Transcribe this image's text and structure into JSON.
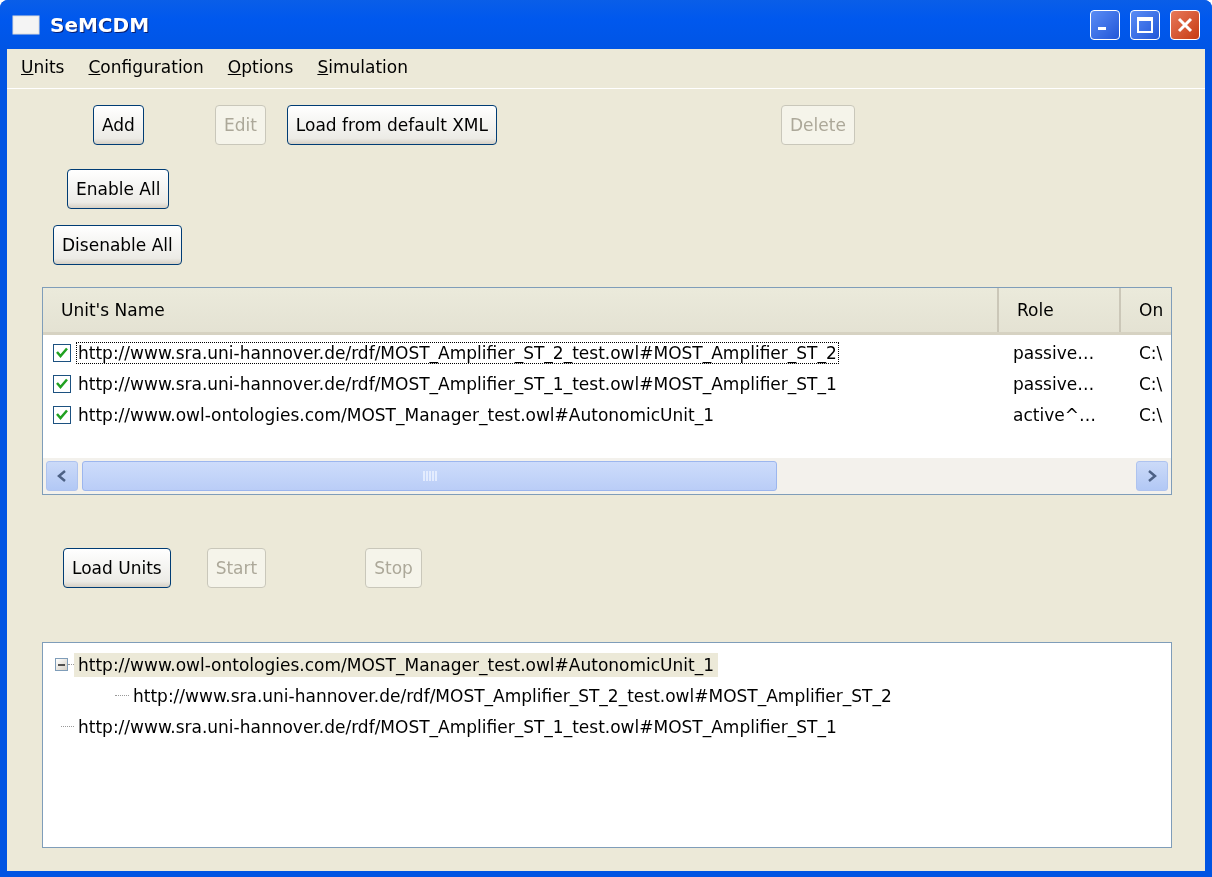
{
  "window": {
    "title": "SeMCDM"
  },
  "menu": [
    "Units",
    "Configuration",
    "Options",
    "Simulation"
  ],
  "unit_buttons": [
    {
      "label": "Add",
      "disabled": false
    },
    {
      "label": "Edit",
      "disabled": true
    },
    {
      "label": "Load from default XML",
      "disabled": false
    },
    {
      "label": "Delete",
      "disabled": true
    }
  ],
  "enable_buttons": [
    {
      "label": "Enable All",
      "disabled": false
    },
    {
      "label": "Disenable All",
      "disabled": false
    }
  ],
  "table": {
    "columns": [
      "Unit's Name",
      "Role",
      "On"
    ],
    "rows": [
      {
        "checked": true,
        "focused": true,
        "cells": [
          "http://www.sra.uni-hannover.de/rdf/MOST_Amplifier_ST_2_test.owl#MOST_Amplifier_ST_2",
          "passive…",
          "C:\\"
        ]
      },
      {
        "checked": true,
        "focused": false,
        "cells": [
          "http://www.sra.uni-hannover.de/rdf/MOST_Amplifier_ST_1_test.owl#MOST_Amplifier_ST_1",
          "passive…",
          "C:\\"
        ]
      },
      {
        "checked": true,
        "focused": false,
        "cells": [
          "http://www.owl-ontologies.com/MOST_Manager_test.owl#AutonomicUnit_1",
          "active^…",
          "C:\\"
        ]
      }
    ]
  },
  "run_buttons": [
    {
      "label": "Load Units",
      "disabled": false
    },
    {
      "label": "Start",
      "disabled": true
    },
    {
      "label": "Stop",
      "disabled": true
    }
  ],
  "tree": [
    {
      "label": "http://www.owl-ontologies.com/MOST_Manager_test.owl#AutonomicUnit_1",
      "selected": true,
      "expanded": true,
      "children": [
        {
          "label": "http://www.sra.uni-hannover.de/rdf/MOST_Amplifier_ST_2_test.owl#MOST_Amplifier_ST_2",
          "selected": false
        }
      ]
    },
    {
      "label": "http://www.sra.uni-hannover.de/rdf/MOST_Amplifier_ST_1_test.owl#MOST_Amplifier_ST_1",
      "selected": false
    }
  ]
}
